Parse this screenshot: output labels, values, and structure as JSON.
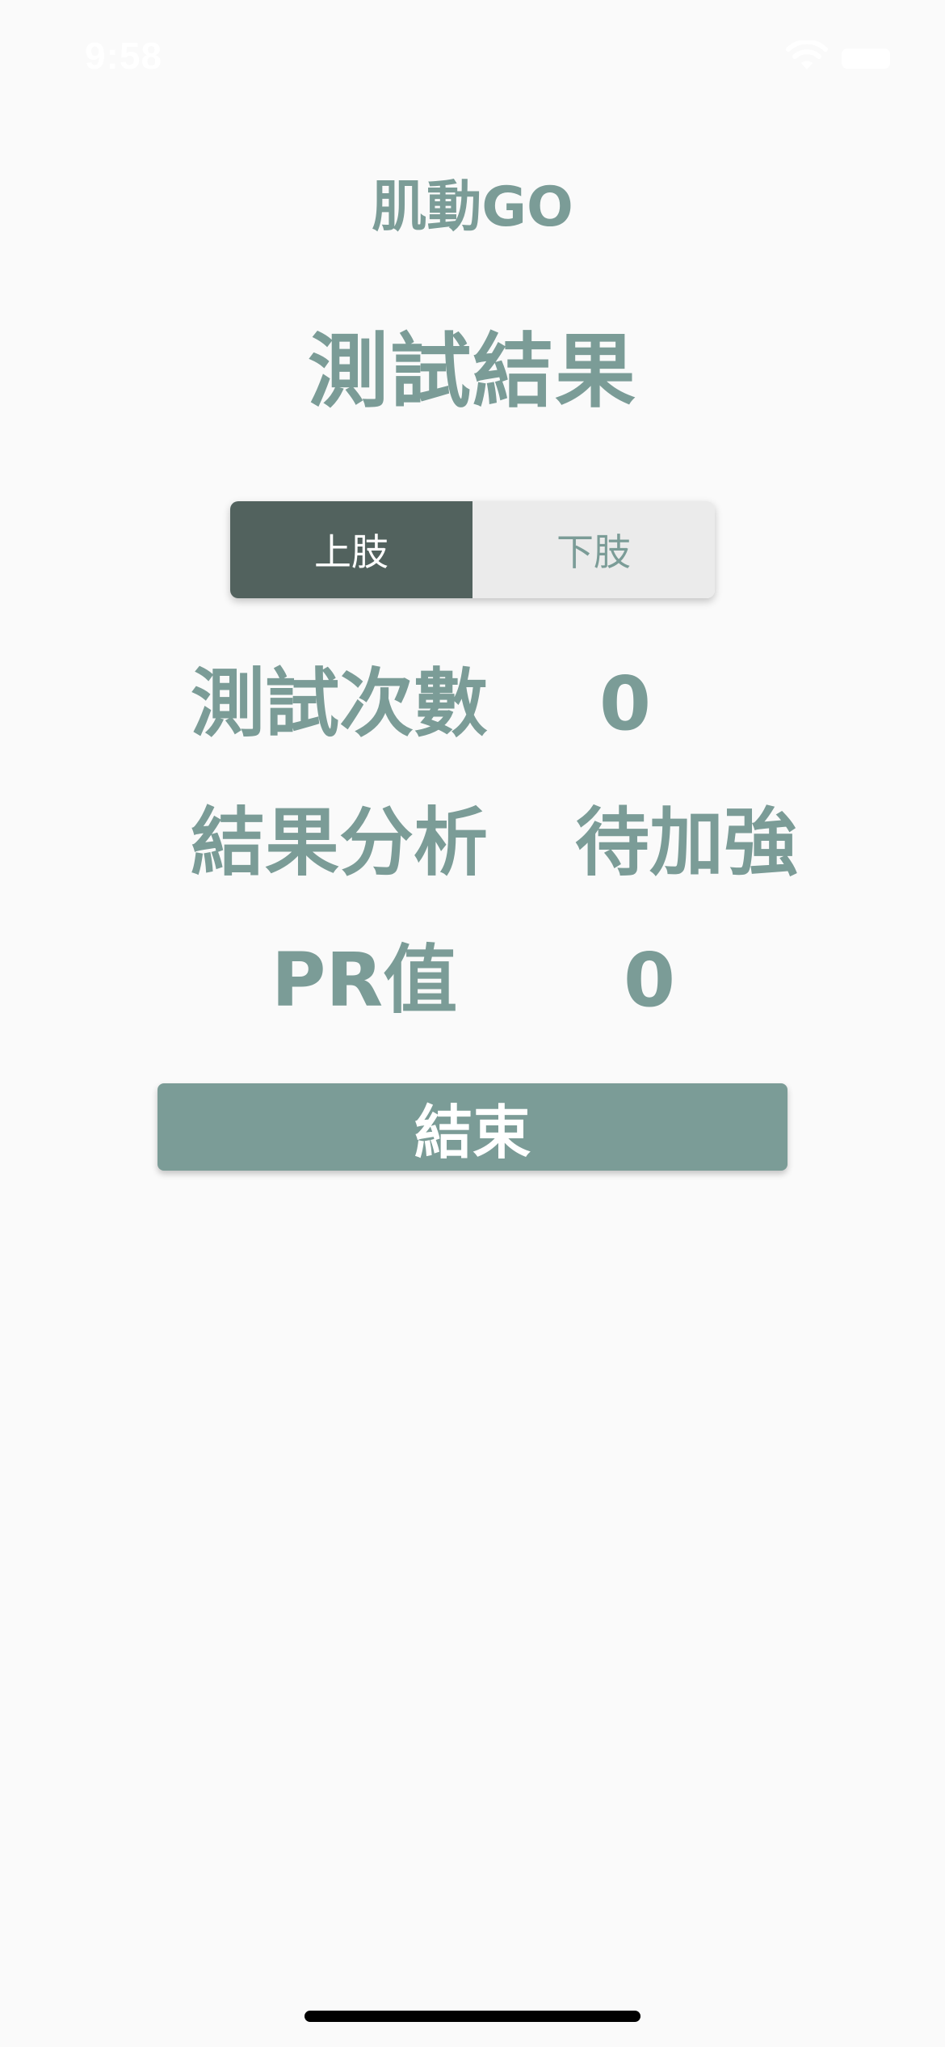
{
  "status_bar": {
    "time": "9:58"
  },
  "app": {
    "title": "肌動GO"
  },
  "page": {
    "heading": "測試結果"
  },
  "segments": {
    "active_label": "上肢",
    "inactive_label": "下肢"
  },
  "stats": {
    "test_count_label": "測試次數",
    "test_count_value": "0",
    "analysis_label": "結果分析",
    "analysis_value": "待加強",
    "pr_label": "PR值",
    "pr_value": "0"
  },
  "actions": {
    "end_label": "結束"
  },
  "colors": {
    "accent": "#7b9c97",
    "active_segment": "#52625e",
    "inactive_segment": "#ebebeb",
    "background": "#fafafa"
  },
  "icons": [
    "wifi-icon",
    "battery-icon"
  ]
}
